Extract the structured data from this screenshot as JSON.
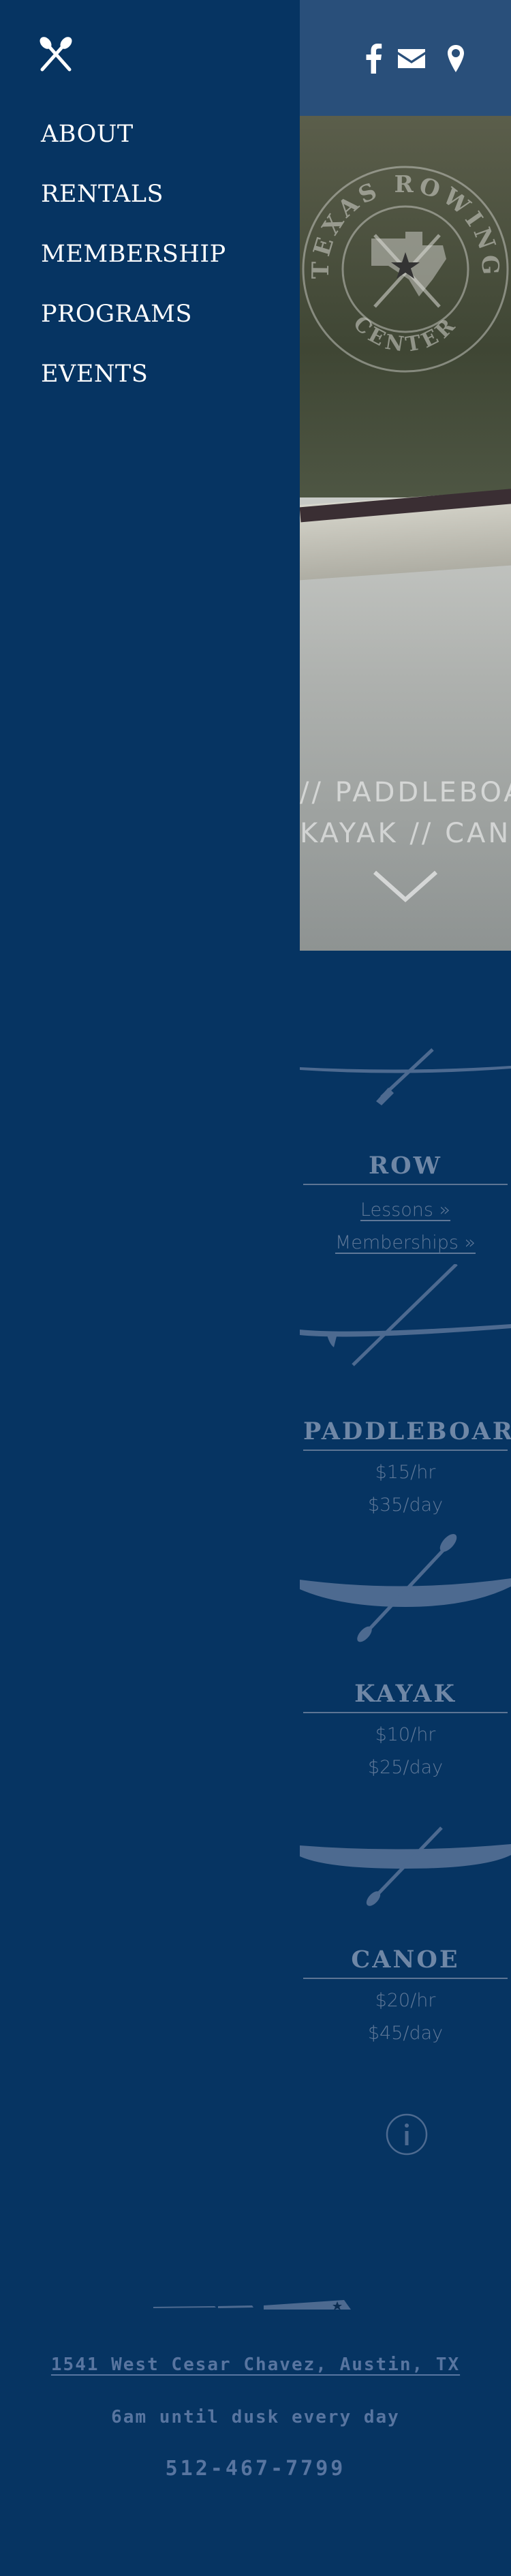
{
  "nav": {
    "items": [
      "ABOUT",
      "RENTALS",
      "MEMBERSHIP",
      "PROGRAMS",
      "EVENTS"
    ]
  },
  "hero": {
    "seal_text_top": "TEXAS ROWING",
    "seal_text_bottom": "CENTER",
    "line1": "// PADDLEBOARD //",
    "line2": "KAYAK // CANOE //"
  },
  "rentals": [
    {
      "title": "ROW",
      "lines": [
        "Lessons »",
        "Memberships »"
      ],
      "links": true
    },
    {
      "title": "PADDLEBOARD",
      "lines": [
        "$15/hr",
        "$35/day"
      ],
      "links": false
    },
    {
      "title": "KAYAK",
      "lines": [
        "$10/hr",
        "$25/day"
      ],
      "links": false
    },
    {
      "title": "CANOE",
      "lines": [
        "$20/hr",
        "$45/day"
      ],
      "links": false
    }
  ],
  "footer": {
    "address": "1541 West Cesar Chavez, Austin, TX",
    "hours": "6am until dusk every day",
    "phone": "512-467-7799"
  },
  "colors": {
    "background": "#063462",
    "topbar": "#294f7a",
    "muted_text": "#6f87a6"
  },
  "icons": [
    "close-oars-icon",
    "facebook-icon",
    "mail-icon",
    "location-pin-icon",
    "chevron-down-icon",
    "info-icon"
  ]
}
